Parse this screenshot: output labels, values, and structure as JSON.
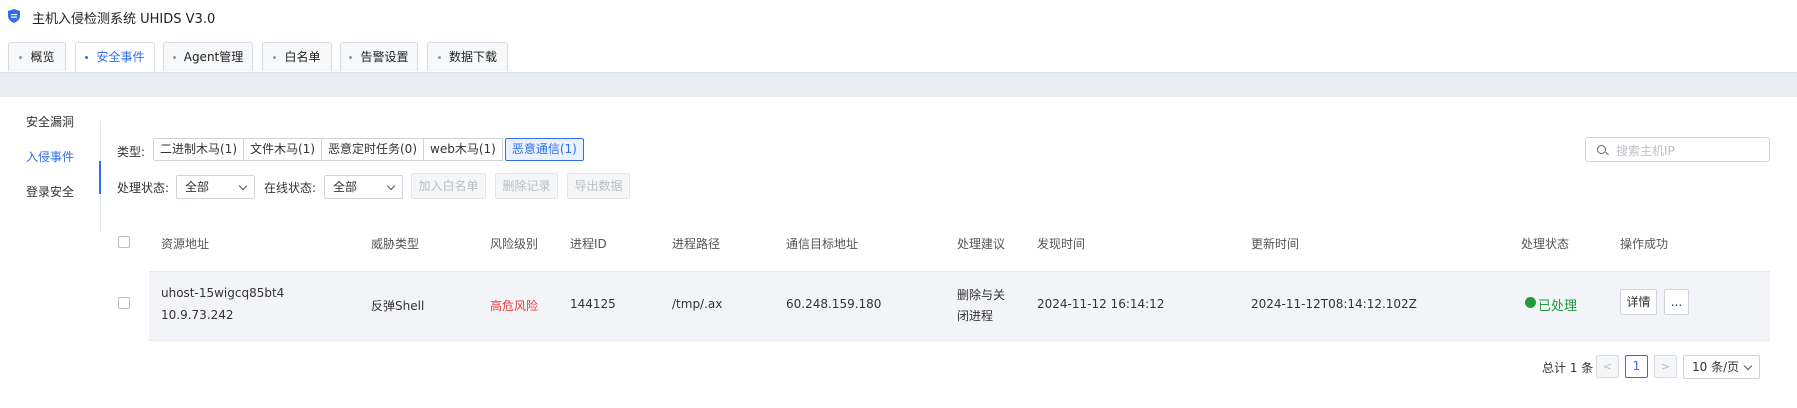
{
  "app": {
    "title": "主机入侵检测系统 UHIDS V3.0",
    "logo_icon": "shield-icon"
  },
  "tabs": [
    {
      "label": "概览"
    },
    {
      "label": "安全事件",
      "active": true
    },
    {
      "label": "Agent管理"
    },
    {
      "label": "白名单"
    },
    {
      "label": "告警设置"
    },
    {
      "label": "数据下载"
    }
  ],
  "sidebar": {
    "items": [
      {
        "label": "安全漏洞"
      },
      {
        "label": "入侵事件",
        "active": true
      },
      {
        "label": "登录安全"
      }
    ]
  },
  "filters": {
    "type_label": "类型:",
    "types": [
      {
        "label": "二进制木马(1)"
      },
      {
        "label": "文件木马(1)"
      },
      {
        "label": "恶意定时任务(0)"
      },
      {
        "label": "web木马(1)"
      },
      {
        "label": "恶意通信(1)",
        "active": true
      }
    ],
    "process_status_label": "处理状态:",
    "process_status_value": "全部",
    "online_status_label": "在线状态:",
    "online_status_value": "全部",
    "add_whitelist": "加入白名单",
    "delete_records": "删除记录",
    "export_data": "导出数据",
    "search_placeholder": "搜索主机IP"
  },
  "table": {
    "columns": [
      "资源地址",
      "威胁类型",
      "风险级别",
      "进程ID",
      "进程路径",
      "通信目标地址",
      "处理建议",
      "发现时间",
      "更新时间",
      "处理状态",
      "操作成功"
    ],
    "rows": [
      {
        "host": "uhost-15wigcq85bt4",
        "ip": "10.9.73.242",
        "threat_type": "反弹Shell",
        "risk": "高危风险",
        "pid": "144125",
        "path": "/tmp/.ax",
        "target": "60.248.159.180",
        "suggestion_line1": "删除与关",
        "suggestion_line2": "闭进程",
        "found_time": "2024-11-12 16:14:12",
        "update_time": "2024-11-12T08:14:12.102Z",
        "status": "已处理",
        "detail_btn": "详情",
        "more_btn": "..."
      }
    ]
  },
  "pagination": {
    "total_text": "总计 1 条",
    "prev": "<",
    "current": "1",
    "next": ">",
    "page_size": "10 条/页"
  },
  "colors": {
    "accent": "#2f6fed",
    "risk_high": "#e83b3b",
    "handled": "#1f9b3a"
  }
}
